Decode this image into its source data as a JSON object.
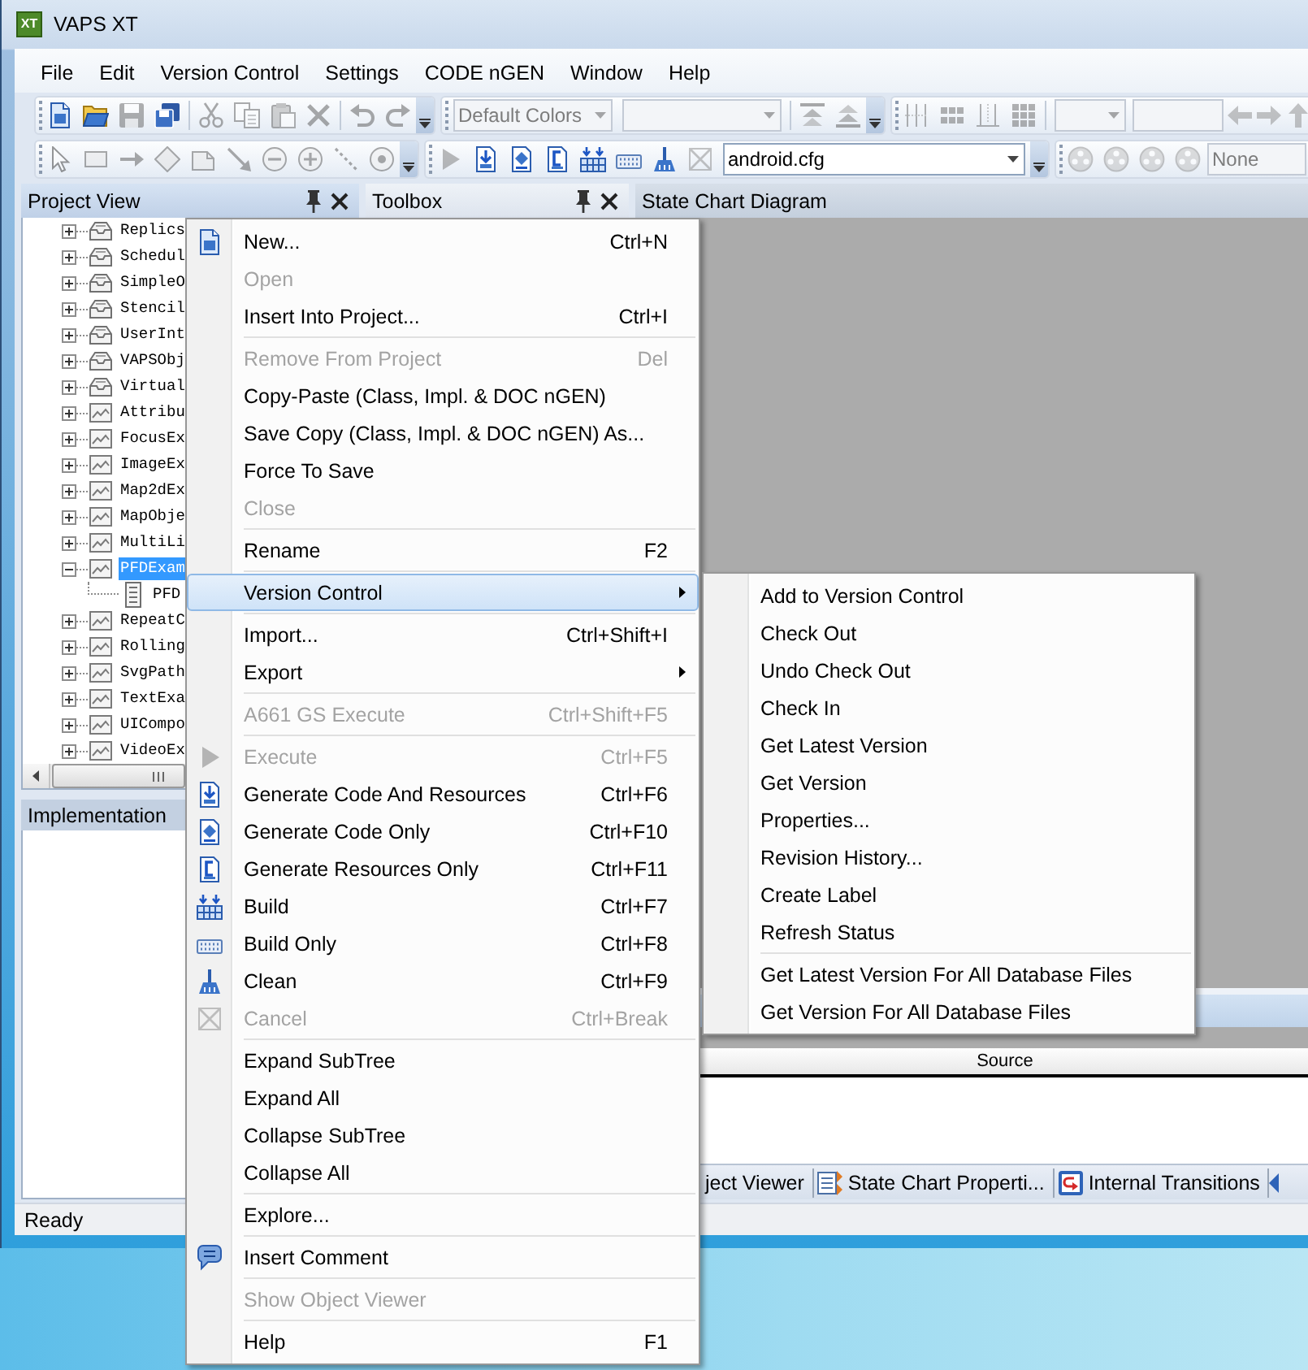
{
  "window": {
    "logo": "XT",
    "title": "VAPS XT"
  },
  "menu_bar": [
    "File",
    "Edit",
    "Version Control",
    "Settings",
    "CODE nGEN",
    "Window",
    "Help"
  ],
  "toolbars": [
    {
      "bands": [
        {
          "overflow": true,
          "items": [
            {
              "kind": "button",
              "disabled": false
            },
            {
              "kind": "button",
              "disabled": false
            },
            {
              "kind": "button",
              "disabled": true
            },
            {
              "kind": "button",
              "disabled": false
            },
            {
              "kind": "separator"
            },
            {
              "kind": "button",
              "disabled": true
            },
            {
              "kind": "button",
              "disabled": true
            },
            {
              "kind": "button",
              "disabled": true
            },
            {
              "kind": "button",
              "disabled": true
            },
            {
              "kind": "separator"
            },
            {
              "kind": "button",
              "disabled": true
            },
            {
              "kind": "button",
              "disabled": true
            }
          ]
        },
        {
          "overflow": true,
          "items": [
            {
              "kind": "combo",
              "disabled": true,
              "value": "Default Colors"
            },
            {
              "kind": "combo",
              "disabled": true
            },
            {
              "kind": "separator"
            },
            {
              "kind": "button",
              "disabled": true
            },
            {
              "kind": "button",
              "disabled": true
            }
          ]
        },
        {
          "overflow": false,
          "items": [
            {
              "kind": "button",
              "disabled": true
            },
            {
              "kind": "button",
              "disabled": true
            },
            {
              "kind": "button",
              "disabled": true
            },
            {
              "kind": "button",
              "disabled": true
            },
            {
              "kind": "separator"
            },
            {
              "kind": "combo",
              "disabled": true
            },
            {
              "kind": "field",
              "disabled": true
            },
            {
              "kind": "button",
              "disabled": true
            },
            {
              "kind": "button",
              "disabled": true
            },
            {
              "kind": "button",
              "disabled": true
            }
          ]
        }
      ]
    },
    {
      "bands": [
        {
          "overflow": true,
          "items": [
            {
              "kind": "button",
              "disabled": true
            },
            {
              "kind": "button",
              "disabled": true
            },
            {
              "kind": "button",
              "disabled": true
            },
            {
              "kind": "button",
              "disabled": true
            },
            {
              "kind": "button",
              "disabled": true
            },
            {
              "kind": "button",
              "disabled": true
            },
            {
              "kind": "button",
              "disabled": true
            },
            {
              "kind": "button",
              "disabled": true
            },
            {
              "kind": "button",
              "disabled": true
            },
            {
              "kind": "button",
              "disabled": true
            }
          ]
        },
        {
          "overflow": true,
          "items": [
            {
              "kind": "button",
              "disabled": true
            },
            {
              "kind": "button",
              "disabled": false
            },
            {
              "kind": "button",
              "disabled": false
            },
            {
              "kind": "button",
              "disabled": false
            },
            {
              "kind": "button",
              "disabled": false
            },
            {
              "kind": "button",
              "disabled": false
            },
            {
              "kind": "button",
              "disabled": false
            },
            {
              "kind": "button",
              "disabled": true
            },
            {
              "kind": "combo",
              "disabled": false,
              "value": "android.cfg"
            }
          ]
        },
        {
          "overflow": false,
          "items": [
            {
              "kind": "button",
              "disabled": true
            },
            {
              "kind": "button",
              "disabled": true
            },
            {
              "kind": "button",
              "disabled": true
            },
            {
              "kind": "button",
              "disabled": true
            },
            {
              "kind": "field",
              "disabled": true,
              "value": "None"
            }
          ]
        }
      ]
    }
  ],
  "project_view": {
    "title": "Project View",
    "tree": [
      {
        "label": "Replics",
        "kind": "package",
        "expanded": false,
        "selected": false
      },
      {
        "label": "Schedul",
        "kind": "package",
        "expanded": false,
        "selected": false
      },
      {
        "label": "SimpleO",
        "kind": "package",
        "expanded": false,
        "selected": false
      },
      {
        "label": "Stencil",
        "kind": "package",
        "expanded": false,
        "selected": false
      },
      {
        "label": "UserInt",
        "kind": "package",
        "expanded": false,
        "selected": false
      },
      {
        "label": "VAPSObj",
        "kind": "package",
        "expanded": false,
        "selected": false
      },
      {
        "label": "Virtual",
        "kind": "package",
        "expanded": false,
        "selected": false
      },
      {
        "label": "Attribu",
        "kind": "image",
        "expanded": false,
        "selected": false
      },
      {
        "label": "FocusEx",
        "kind": "image",
        "expanded": false,
        "selected": false
      },
      {
        "label": "ImageEx",
        "kind": "image",
        "expanded": false,
        "selected": false
      },
      {
        "label": "Map2dEx",
        "kind": "image",
        "expanded": false,
        "selected": false
      },
      {
        "label": "MapObje",
        "kind": "image",
        "expanded": false,
        "selected": false
      },
      {
        "label": "MultiLi",
        "kind": "image",
        "expanded": false,
        "selected": false
      },
      {
        "label": "PFDExam",
        "kind": "image",
        "expanded": true,
        "selected": true,
        "children": [
          {
            "label": "PFD",
            "kind": "document",
            "selected": false
          }
        ]
      },
      {
        "label": "RepeatC",
        "kind": "image",
        "expanded": false,
        "selected": false
      },
      {
        "label": "Rolling",
        "kind": "image",
        "expanded": false,
        "selected": false
      },
      {
        "label": "SvgPath",
        "kind": "image",
        "expanded": false,
        "selected": false
      },
      {
        "label": "TextExa",
        "kind": "image",
        "expanded": false,
        "selected": false
      },
      {
        "label": "UICompo",
        "kind": "image",
        "expanded": false,
        "selected": false
      },
      {
        "label": "VideoEx",
        "kind": "image",
        "expanded": false,
        "selected": false
      }
    ]
  },
  "implementation_view": {
    "title": "Implementation"
  },
  "toolbox": {
    "title": "Toolbox"
  },
  "state_chart_diagram": {
    "title": "State Chart Diagram"
  },
  "source_panel": {
    "column_header": "Source"
  },
  "bottom_tabs": [
    {
      "label": "ject Viewer"
    },
    {
      "label": "State Chart Properti..."
    },
    {
      "label": "Internal Transitions"
    }
  ],
  "status_bar": "Ready",
  "context_menu": {
    "items": [
      {
        "kind": "item",
        "label": "New...",
        "shortcut": "Ctrl+N",
        "disabled": false,
        "highlighted": false
      },
      {
        "kind": "item",
        "label": "Open",
        "disabled": true,
        "highlighted": false
      },
      {
        "kind": "item",
        "label": "Insert Into Project...",
        "shortcut": "Ctrl+I",
        "disabled": false,
        "highlighted": false
      },
      {
        "kind": "separator"
      },
      {
        "kind": "item",
        "label": "Remove From Project",
        "shortcut": "Del",
        "disabled": true,
        "highlighted": false
      },
      {
        "kind": "item",
        "label": "Copy-Paste (Class, Impl. & DOC nGEN)",
        "disabled": false,
        "highlighted": false
      },
      {
        "kind": "item",
        "label": "Save Copy (Class, Impl. & DOC nGEN) As...",
        "disabled": false,
        "highlighted": false
      },
      {
        "kind": "item",
        "label": "Force To Save",
        "disabled": false,
        "highlighted": false
      },
      {
        "kind": "item",
        "label": "Close",
        "disabled": true,
        "highlighted": false
      },
      {
        "kind": "separator"
      },
      {
        "kind": "item",
        "label": "Rename",
        "shortcut": "F2",
        "disabled": false,
        "highlighted": false
      },
      {
        "kind": "separator"
      },
      {
        "kind": "submenu",
        "label": "Version Control",
        "disabled": false,
        "highlighted": true
      },
      {
        "kind": "separator"
      },
      {
        "kind": "item",
        "label": "Import...",
        "shortcut": "Ctrl+Shift+I",
        "disabled": false,
        "highlighted": false
      },
      {
        "kind": "submenu",
        "label": "Export",
        "disabled": false,
        "highlighted": false
      },
      {
        "kind": "separator"
      },
      {
        "kind": "item",
        "label": "A661 GS Execute",
        "shortcut": "Ctrl+Shift+F5",
        "disabled": true,
        "highlighted": false
      },
      {
        "kind": "separator"
      },
      {
        "kind": "item",
        "label": "Execute",
        "shortcut": "Ctrl+F5",
        "disabled": true,
        "highlighted": false
      },
      {
        "kind": "item",
        "label": "Generate Code And Resources",
        "shortcut": "Ctrl+F6",
        "disabled": false,
        "highlighted": false
      },
      {
        "kind": "item",
        "label": "Generate Code Only",
        "shortcut": "Ctrl+F10",
        "disabled": false,
        "highlighted": false
      },
      {
        "kind": "item",
        "label": "Generate Resources Only",
        "shortcut": "Ctrl+F11",
        "disabled": false,
        "highlighted": false
      },
      {
        "kind": "item",
        "label": "Build",
        "shortcut": "Ctrl+F7",
        "disabled": false,
        "highlighted": false
      },
      {
        "kind": "item",
        "label": "Build Only",
        "shortcut": "Ctrl+F8",
        "disabled": false,
        "highlighted": false
      },
      {
        "kind": "item",
        "label": "Clean",
        "shortcut": "Ctrl+F9",
        "disabled": false,
        "highlighted": false
      },
      {
        "kind": "item",
        "label": "Cancel",
        "shortcut": "Ctrl+Break",
        "disabled": true,
        "highlighted": false
      },
      {
        "kind": "separator"
      },
      {
        "kind": "item",
        "label": "Expand SubTree",
        "disabled": false,
        "highlighted": false
      },
      {
        "kind": "item",
        "label": "Expand All",
        "disabled": false,
        "highlighted": false
      },
      {
        "kind": "item",
        "label": "Collapse SubTree",
        "disabled": false,
        "highlighted": false
      },
      {
        "kind": "item",
        "label": "Collapse All",
        "disabled": false,
        "highlighted": false
      },
      {
        "kind": "separator"
      },
      {
        "kind": "item",
        "label": "Explore...",
        "disabled": false,
        "highlighted": false
      },
      {
        "kind": "separator"
      },
      {
        "kind": "item",
        "label": "Insert Comment",
        "disabled": false,
        "highlighted": false
      },
      {
        "kind": "separator"
      },
      {
        "kind": "item",
        "label": "Show Object Viewer",
        "disabled": true,
        "highlighted": false
      },
      {
        "kind": "separator"
      },
      {
        "kind": "item",
        "label": "Help",
        "shortcut": "F1",
        "disabled": false,
        "highlighted": false
      }
    ]
  },
  "version_control_submenu": {
    "items": [
      {
        "kind": "item",
        "label": "Add to Version Control"
      },
      {
        "kind": "item",
        "label": "Check Out"
      },
      {
        "kind": "item",
        "label": "Undo Check Out"
      },
      {
        "kind": "item",
        "label": "Check In"
      },
      {
        "kind": "item",
        "label": "Get Latest Version"
      },
      {
        "kind": "item",
        "label": "Get Version"
      },
      {
        "kind": "item",
        "label": "Properties..."
      },
      {
        "kind": "item",
        "label": "Revision History..."
      },
      {
        "kind": "item",
        "label": "Create Label"
      },
      {
        "kind": "item",
        "label": "Refresh Status"
      },
      {
        "kind": "separator"
      },
      {
        "kind": "item",
        "label": "Get Latest Version For All Database Files"
      },
      {
        "kind": "item",
        "label": "Get Version For All Database Files"
      }
    ]
  }
}
